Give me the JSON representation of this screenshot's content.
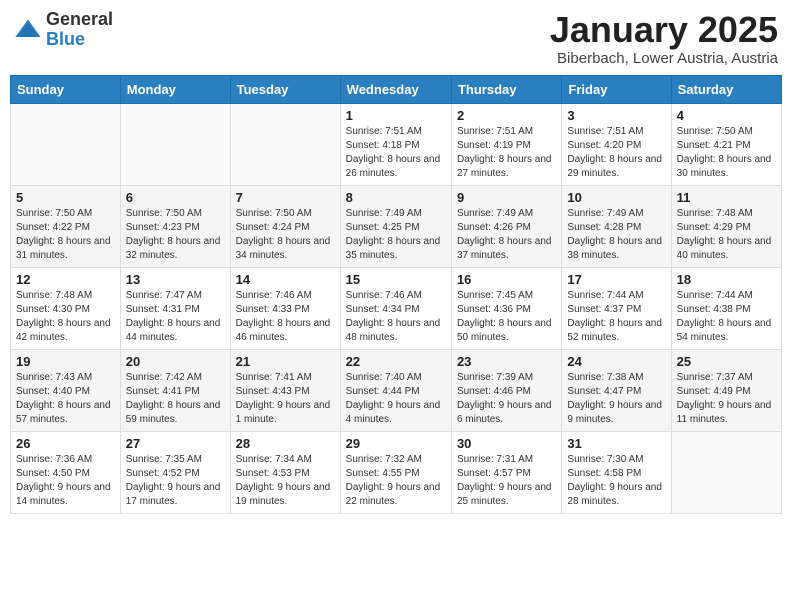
{
  "header": {
    "logo_general": "General",
    "logo_blue": "Blue",
    "month_title": "January 2025",
    "location": "Biberbach, Lower Austria, Austria"
  },
  "days_of_week": [
    "Sunday",
    "Monday",
    "Tuesday",
    "Wednesday",
    "Thursday",
    "Friday",
    "Saturday"
  ],
  "weeks": [
    [
      {
        "day": "",
        "info": ""
      },
      {
        "day": "",
        "info": ""
      },
      {
        "day": "",
        "info": ""
      },
      {
        "day": "1",
        "info": "Sunrise: 7:51 AM\nSunset: 4:18 PM\nDaylight: 8 hours and 26 minutes."
      },
      {
        "day": "2",
        "info": "Sunrise: 7:51 AM\nSunset: 4:19 PM\nDaylight: 8 hours and 27 minutes."
      },
      {
        "day": "3",
        "info": "Sunrise: 7:51 AM\nSunset: 4:20 PM\nDaylight: 8 hours and 29 minutes."
      },
      {
        "day": "4",
        "info": "Sunrise: 7:50 AM\nSunset: 4:21 PM\nDaylight: 8 hours and 30 minutes."
      }
    ],
    [
      {
        "day": "5",
        "info": "Sunrise: 7:50 AM\nSunset: 4:22 PM\nDaylight: 8 hours and 31 minutes."
      },
      {
        "day": "6",
        "info": "Sunrise: 7:50 AM\nSunset: 4:23 PM\nDaylight: 8 hours and 32 minutes."
      },
      {
        "day": "7",
        "info": "Sunrise: 7:50 AM\nSunset: 4:24 PM\nDaylight: 8 hours and 34 minutes."
      },
      {
        "day": "8",
        "info": "Sunrise: 7:49 AM\nSunset: 4:25 PM\nDaylight: 8 hours and 35 minutes."
      },
      {
        "day": "9",
        "info": "Sunrise: 7:49 AM\nSunset: 4:26 PM\nDaylight: 8 hours and 37 minutes."
      },
      {
        "day": "10",
        "info": "Sunrise: 7:49 AM\nSunset: 4:28 PM\nDaylight: 8 hours and 38 minutes."
      },
      {
        "day": "11",
        "info": "Sunrise: 7:48 AM\nSunset: 4:29 PM\nDaylight: 8 hours and 40 minutes."
      }
    ],
    [
      {
        "day": "12",
        "info": "Sunrise: 7:48 AM\nSunset: 4:30 PM\nDaylight: 8 hours and 42 minutes."
      },
      {
        "day": "13",
        "info": "Sunrise: 7:47 AM\nSunset: 4:31 PM\nDaylight: 8 hours and 44 minutes."
      },
      {
        "day": "14",
        "info": "Sunrise: 7:46 AM\nSunset: 4:33 PM\nDaylight: 8 hours and 46 minutes."
      },
      {
        "day": "15",
        "info": "Sunrise: 7:46 AM\nSunset: 4:34 PM\nDaylight: 8 hours and 48 minutes."
      },
      {
        "day": "16",
        "info": "Sunrise: 7:45 AM\nSunset: 4:36 PM\nDaylight: 8 hours and 50 minutes."
      },
      {
        "day": "17",
        "info": "Sunrise: 7:44 AM\nSunset: 4:37 PM\nDaylight: 8 hours and 52 minutes."
      },
      {
        "day": "18",
        "info": "Sunrise: 7:44 AM\nSunset: 4:38 PM\nDaylight: 8 hours and 54 minutes."
      }
    ],
    [
      {
        "day": "19",
        "info": "Sunrise: 7:43 AM\nSunset: 4:40 PM\nDaylight: 8 hours and 57 minutes."
      },
      {
        "day": "20",
        "info": "Sunrise: 7:42 AM\nSunset: 4:41 PM\nDaylight: 8 hours and 59 minutes."
      },
      {
        "day": "21",
        "info": "Sunrise: 7:41 AM\nSunset: 4:43 PM\nDaylight: 9 hours and 1 minute."
      },
      {
        "day": "22",
        "info": "Sunrise: 7:40 AM\nSunset: 4:44 PM\nDaylight: 9 hours and 4 minutes."
      },
      {
        "day": "23",
        "info": "Sunrise: 7:39 AM\nSunset: 4:46 PM\nDaylight: 9 hours and 6 minutes."
      },
      {
        "day": "24",
        "info": "Sunrise: 7:38 AM\nSunset: 4:47 PM\nDaylight: 9 hours and 9 minutes."
      },
      {
        "day": "25",
        "info": "Sunrise: 7:37 AM\nSunset: 4:49 PM\nDaylight: 9 hours and 11 minutes."
      }
    ],
    [
      {
        "day": "26",
        "info": "Sunrise: 7:36 AM\nSunset: 4:50 PM\nDaylight: 9 hours and 14 minutes."
      },
      {
        "day": "27",
        "info": "Sunrise: 7:35 AM\nSunset: 4:52 PM\nDaylight: 9 hours and 17 minutes."
      },
      {
        "day": "28",
        "info": "Sunrise: 7:34 AM\nSunset: 4:53 PM\nDaylight: 9 hours and 19 minutes."
      },
      {
        "day": "29",
        "info": "Sunrise: 7:32 AM\nSunset: 4:55 PM\nDaylight: 9 hours and 22 minutes."
      },
      {
        "day": "30",
        "info": "Sunrise: 7:31 AM\nSunset: 4:57 PM\nDaylight: 9 hours and 25 minutes."
      },
      {
        "day": "31",
        "info": "Sunrise: 7:30 AM\nSunset: 4:58 PM\nDaylight: 9 hours and 28 minutes."
      },
      {
        "day": "",
        "info": ""
      }
    ]
  ]
}
